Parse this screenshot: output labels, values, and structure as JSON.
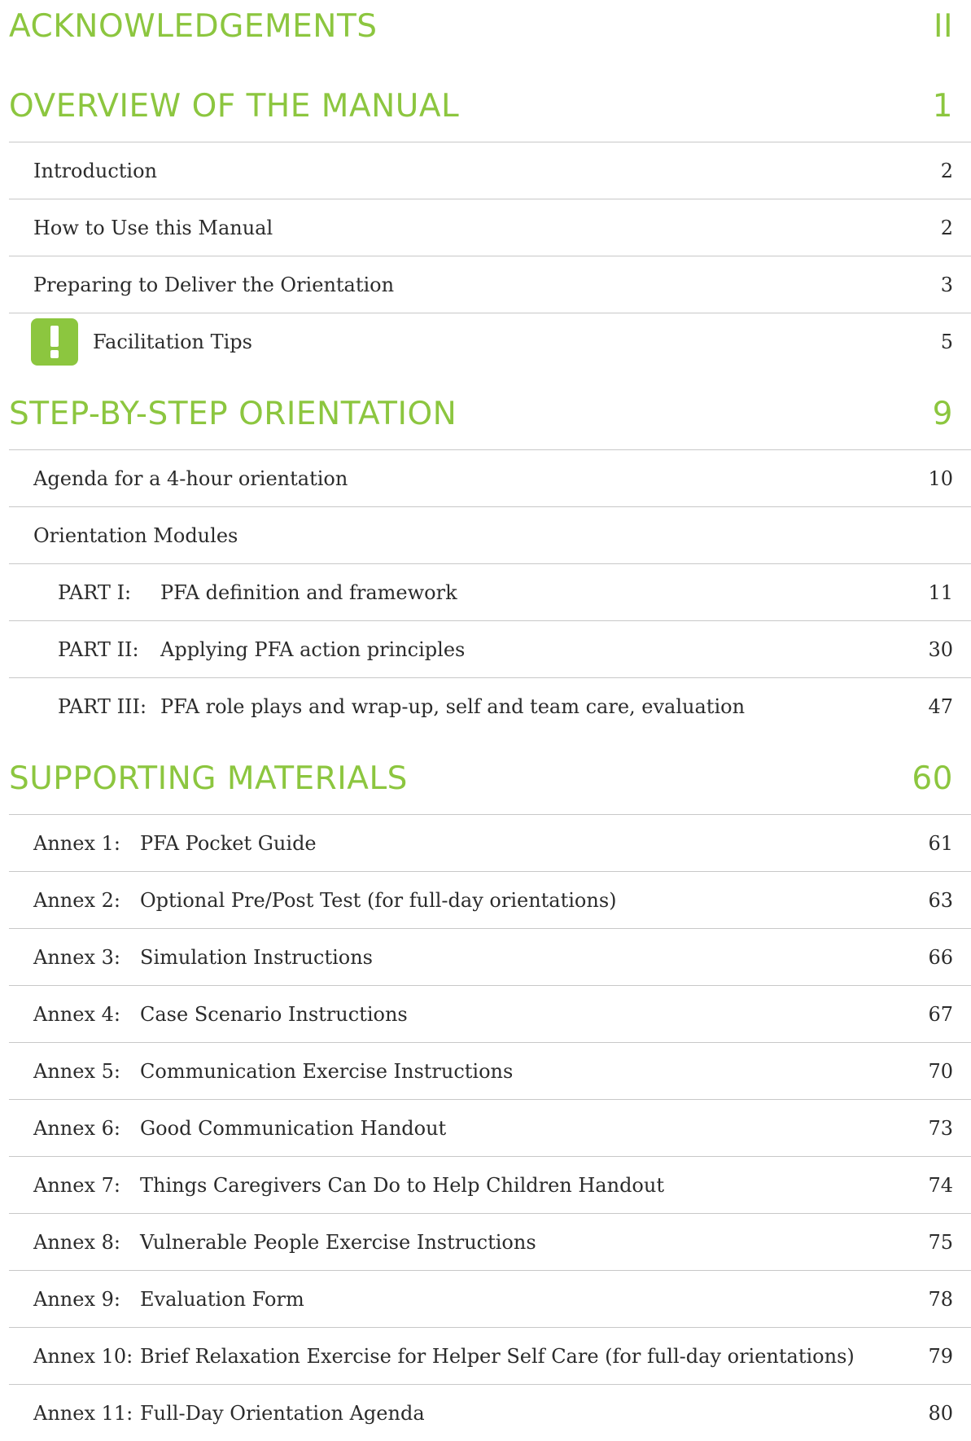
{
  "sections": {
    "acknowledgements": {
      "title": "ACKNOWLEDGEMENTS",
      "page": "II"
    },
    "overview": {
      "title": "OVERVIEW OF THE MANUAL",
      "page": "1",
      "entries": [
        {
          "title": "Introduction",
          "page": "2"
        },
        {
          "title": "How to Use this Manual",
          "page": "2"
        },
        {
          "title": "Preparing to Deliver the Orientation",
          "page": "3"
        },
        {
          "title": "Facilitation Tips",
          "page": "5",
          "icon": "exclamation-icon"
        }
      ]
    },
    "step_by_step": {
      "title": "STEP-BY-STEP ORIENTATION",
      "page": "9",
      "entries": [
        {
          "title": "Agenda for a 4-hour orientation",
          "page": "10"
        },
        {
          "title": "Orientation Modules",
          "page": ""
        }
      ],
      "parts": [
        {
          "label": "PART I:",
          "title": "PFA definition and framework",
          "page": "11"
        },
        {
          "label": "PART II:",
          "title": "Applying PFA action principles",
          "page": "30"
        },
        {
          "label": "PART III:",
          "title": "PFA role plays and wrap-up, self and team care, evaluation",
          "page": "47"
        }
      ]
    },
    "supporting": {
      "title": "SUPPORTING MATERIALS",
      "page": "60",
      "annexes": [
        {
          "label": "Annex 1:",
          "title": "PFA Pocket Guide",
          "page": "61"
        },
        {
          "label": "Annex 2:",
          "title": "Optional Pre/Post Test (for full-day orientations)",
          "page": "63"
        },
        {
          "label": "Annex 3:",
          "title": "Simulation Instructions",
          "page": "66"
        },
        {
          "label": "Annex 4:",
          "title": "Case Scenario Instructions",
          "page": "67"
        },
        {
          "label": "Annex 5:",
          "title": "Communication Exercise Instructions",
          "page": "70"
        },
        {
          "label": "Annex 6:",
          "title": "Good Communication Handout",
          "page": "73"
        },
        {
          "label": "Annex 7:",
          "title": "Things Caregivers Can Do to Help Children Handout",
          "page": "74"
        },
        {
          "label": "Annex 8:",
          "title": "Vulnerable People Exercise Instructions",
          "page": "75"
        },
        {
          "label": "Annex 9:",
          "title": "Evaluation Form",
          "page": "78"
        },
        {
          "label": "Annex 10:",
          "title": "Brief Relaxation Exercise for Helper Self Care (for full-day orientations)",
          "page": "79"
        },
        {
          "label": "Annex 11:",
          "title": "Full-Day Orientation Agenda",
          "page": "80"
        }
      ]
    }
  },
  "colors": {
    "accent": "#8cc63f",
    "text": "#2b2b2b",
    "rule": "#c8c8c8"
  }
}
